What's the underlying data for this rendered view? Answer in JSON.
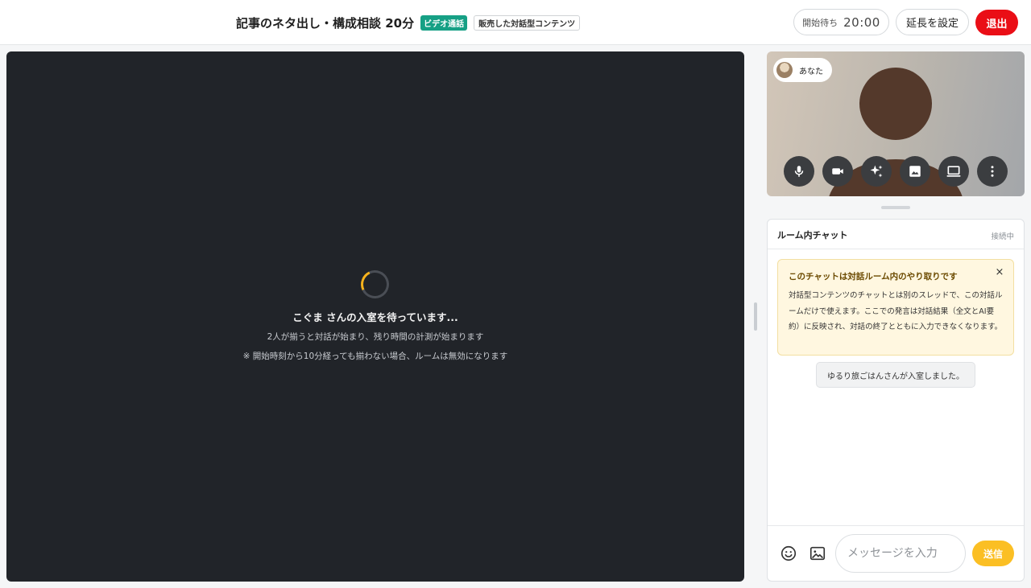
{
  "header": {
    "title": "記事のネタ出し・構成相談 20分",
    "badge_video": "ビデオ通話",
    "badge_sold": "販売した対話型コンテンツ",
    "timer_label": "開始待ち",
    "timer_value": "20:00",
    "extend_label": "延長を設定",
    "exit_label": "退出",
    "colors": {
      "exit": "#ea0e16",
      "video_badge": "#16a085"
    }
  },
  "stage": {
    "wait_title": "こぐま さんの入室を待っています...",
    "wait_sub": "2人が揃うと対話が始まり、残り時間の計測が始まります",
    "wait_note": "※ 開始時刻から10分経っても揃わない場合、ルームは無効になります",
    "spinner_color": "#f6b21c"
  },
  "self_view": {
    "label": "あなた",
    "controls": [
      {
        "name": "mic-icon"
      },
      {
        "name": "camera-icon"
      },
      {
        "name": "sparkle-icon"
      },
      {
        "name": "image-icon"
      },
      {
        "name": "screen-share-icon"
      },
      {
        "name": "more-icon"
      }
    ]
  },
  "chat": {
    "title": "ルーム内チャット",
    "status": "接続中",
    "notice_title": "このチャットは対話ルーム内のやり取りです",
    "notice_close": "×",
    "notice_body": "対話型コンテンツのチャットとは別のスレッドで、この対話ルームだけで使えます。ここでの発言は対話結果（全文とAI要約）に反映され、対話の終了とともに入力できなくなります。",
    "system_message": "ゆるり旅ごはんさんが入室しました。",
    "input_placeholder": "メッセージを入力",
    "send_label": "送信",
    "send_color": "#fbbf24"
  }
}
